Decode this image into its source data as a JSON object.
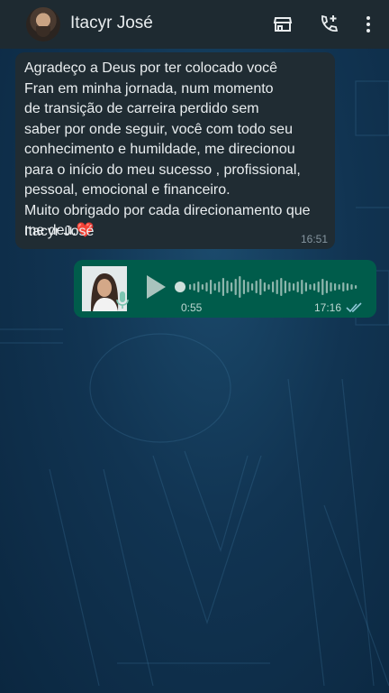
{
  "header": {
    "contact_name": "Itacyr José",
    "icons": [
      "store-icon",
      "add-call-icon",
      "more-vert-icon"
    ]
  },
  "messages": {
    "incoming": {
      "text": "Agradeço a Deus por ter colocado você\nFran em minha jornada, num momento\nde transição de carreira perdido sem\nsaber por onde seguir, você com todo seu\nconhecimento e humildade, me direcionou\npara o início do meu sucesso , profissional,\npessoal, emocional e financeiro.\nMuito obrigado por cada direcionamento que\nme deu.❤️",
      "signature": "Itacyr José",
      "time": "16:51"
    },
    "outgoing_voice": {
      "duration": "0:55",
      "time": "17:16",
      "status": "read",
      "progress": 0
    }
  },
  "colors": {
    "header_bg": "#1e2a31",
    "incoming_bubble": "#202c33",
    "outgoing_bubble": "#005c4b",
    "read_tick": "#8fc8d8"
  }
}
